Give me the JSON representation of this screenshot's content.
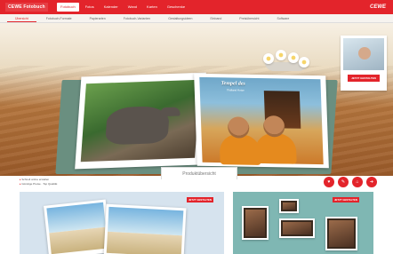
{
  "header": {
    "brand": "CEWE Fotobuch",
    "logo": "CEWE",
    "nav": [
      "Fotobuch",
      "Fotos",
      "Kalender",
      "Wand",
      "Karten",
      "Geschenke"
    ],
    "active_nav_index": 0
  },
  "subnav": {
    "items": [
      "Übersicht",
      "Fotobuch-Formate",
      "Papierarten",
      "Fotobuch-Varianten",
      "Gestaltungsideen",
      "Einband",
      "Preisübersicht",
      "Software"
    ],
    "active_index": 0
  },
  "hero": {
    "book_title": "Tempel des",
    "book_subtitle": "Thailand Reise",
    "promo_button": "JETZT GESTALTEN"
  },
  "section": {
    "title": "Produktübersicht",
    "info_lines": [
      "Schnell online erstellen",
      "Günstige Preise · Top Qualität"
    ],
    "round_buttons": [
      "♥",
      "✎",
      "⌂",
      "➜"
    ]
  },
  "cards": {
    "left_badge": "JETZT GESTALTEN",
    "right_badge": "JETZT GESTALTEN"
  },
  "colors": {
    "brand_red": "#e3242b",
    "teal": "#7fb7b3"
  }
}
